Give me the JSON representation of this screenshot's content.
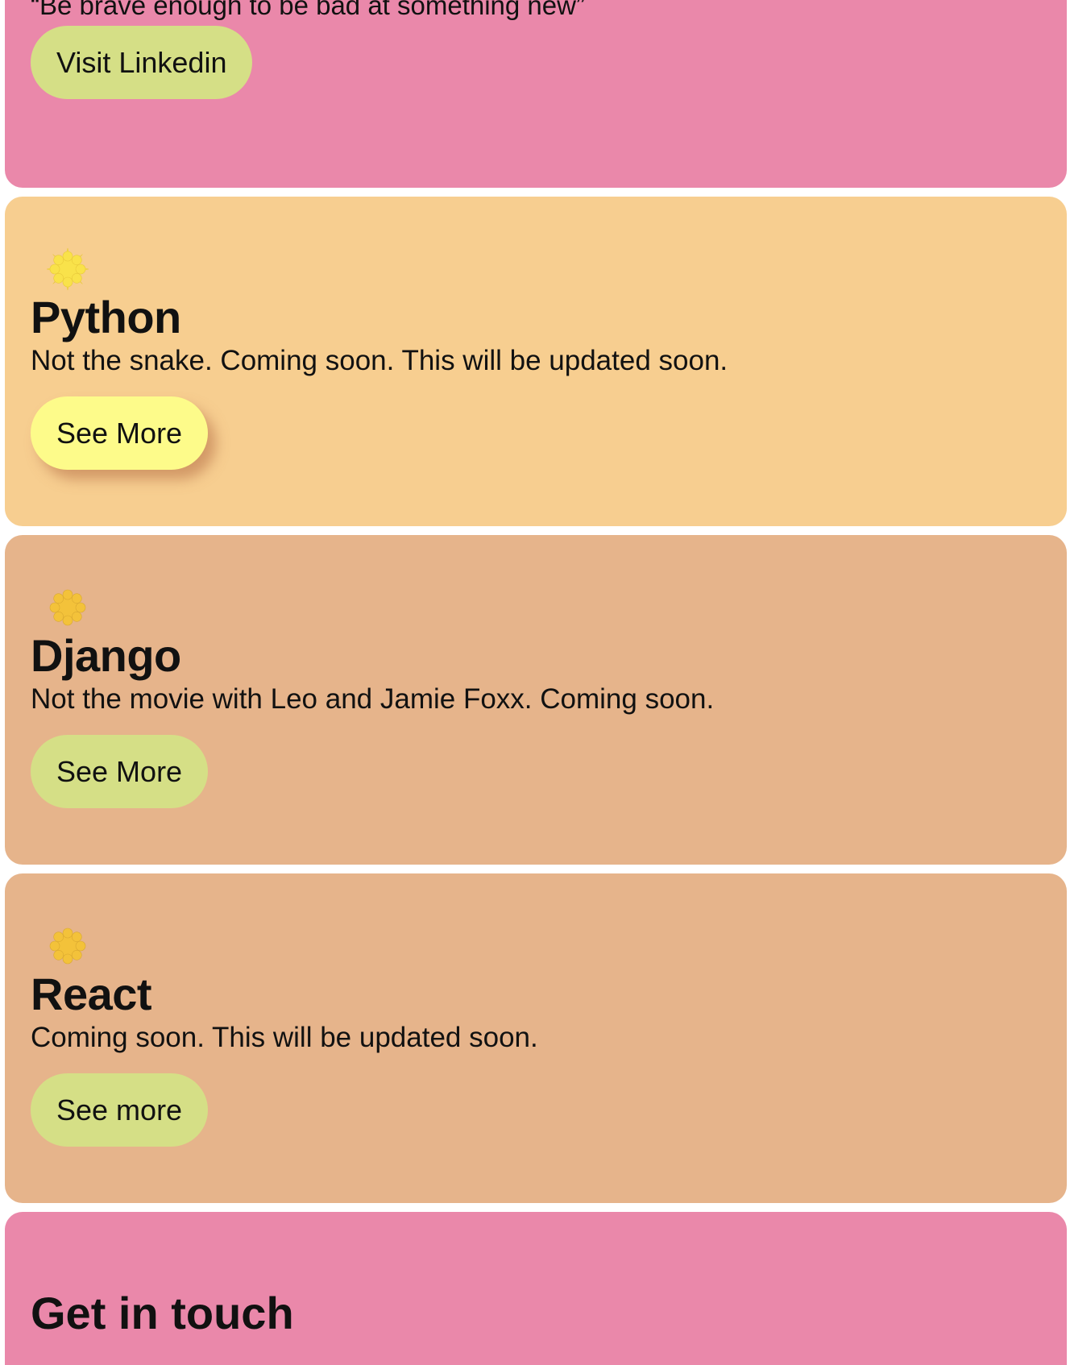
{
  "hero": {
    "quote": "“Be brave enough to be bad at something new”",
    "linkedin_button": "Visit Linkedin"
  },
  "skills": [
    {
      "title": "Python",
      "description": "Not the snake. Coming soon. This will be updated soon.",
      "button": "See More",
      "icon": "sparkle-icon",
      "icon_color": "#f9e24a"
    },
    {
      "title": "Django",
      "description": "Not the movie with Leo and Jamie Foxx. Coming soon.",
      "button": "See More",
      "icon": "sparkle-icon",
      "icon_color": "#f3c23a"
    },
    {
      "title": "React",
      "description": "Coming soon. This will be updated soon.",
      "button": "See more",
      "icon": "sparkle-icon",
      "icon_color": "#f3c23a"
    }
  ],
  "contact": {
    "title": "Get in touch"
  },
  "colors": {
    "pink": "#ea88aa",
    "peach": "#f7ce90",
    "tan": "#e6b48b",
    "button_green": "#d5df86",
    "button_yellow": "#fdfb8a"
  }
}
